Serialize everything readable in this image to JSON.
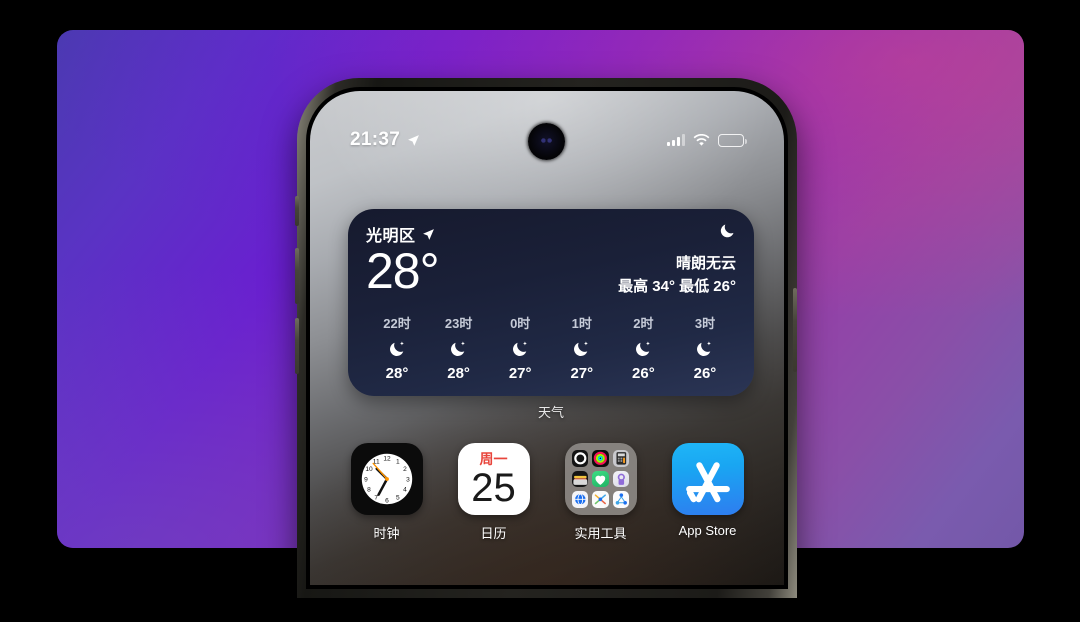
{
  "wallpaper": {
    "desktop_gradient_from": "#4a3bb0",
    "desktop_gradient_via": "#7c1fc8",
    "desktop_gradient_to": "#7358a8"
  },
  "status_bar": {
    "time": "21:37",
    "location_icon": "location-arrow-icon",
    "cellular_icon": "cellular-bars-icon",
    "wifi_icon": "wifi-icon",
    "battery_icon": "battery-icon",
    "battery_level_pct": 32
  },
  "weather_widget": {
    "label": "天气",
    "city": "光明区",
    "location_icon": "location-arrow-icon",
    "condition_icon": "crescent-moon-icon",
    "temperature": "28°",
    "condition": "晴朗无云",
    "high_low": "最高 34° 最低 26°",
    "hourly": [
      {
        "hour": "22时",
        "icon": "moon-stars-icon",
        "temp": "28°"
      },
      {
        "hour": "23时",
        "icon": "moon-stars-icon",
        "temp": "28°"
      },
      {
        "hour": "0时",
        "icon": "moon-stars-icon",
        "temp": "27°"
      },
      {
        "hour": "1时",
        "icon": "moon-stars-icon",
        "temp": "27°"
      },
      {
        "hour": "2时",
        "icon": "moon-stars-icon",
        "temp": "26°"
      },
      {
        "hour": "3时",
        "icon": "moon-stars-icon",
        "temp": "26°"
      }
    ],
    "bg_color": "#1a2038"
  },
  "apps": [
    {
      "name": "时钟",
      "icon": "clock-app-icon"
    },
    {
      "name": "日历",
      "icon": "calendar-app-icon"
    },
    {
      "name": "实用工具",
      "icon": "utilities-folder-icon"
    },
    {
      "name": "App Store",
      "icon": "app-store-icon"
    }
  ],
  "clock_icon": {
    "hour_numbers": [
      "12",
      "1",
      "2",
      "3",
      "4",
      "5",
      "6",
      "7",
      "8",
      "9",
      "10",
      "11"
    ],
    "face_color": "#ffffff",
    "body_color": "#0b0b0b",
    "second_hand_color": "#ff9500"
  },
  "calendar_icon": {
    "weekday": "周一",
    "date": "25",
    "weekday_color": "#e8453c"
  },
  "folder_icon": {
    "mini_apps": [
      "clock-mini-icon",
      "activity-mini-icon",
      "calculator-mini-icon",
      "wallet-mini-icon",
      "health-mini-icon",
      "shortcuts-mini-icon",
      "translate-mini-icon",
      "freeform-mini-icon",
      "files-mini-icon"
    ]
  },
  "app_store_icon": {
    "accent": "#1fb6f7"
  }
}
